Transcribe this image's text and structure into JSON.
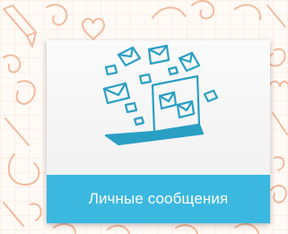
{
  "tile": {
    "label": "Личные сообщения",
    "icon": "laptop-with-envelopes-icon"
  },
  "colors": {
    "accent": "#3cb8e0",
    "icon": "#2a9fc4",
    "background_doodles": "#f2b08e",
    "tile_top": "#fbfbfb",
    "tile_bottom": "#eeeeee",
    "caption_text": "#ffffff"
  }
}
